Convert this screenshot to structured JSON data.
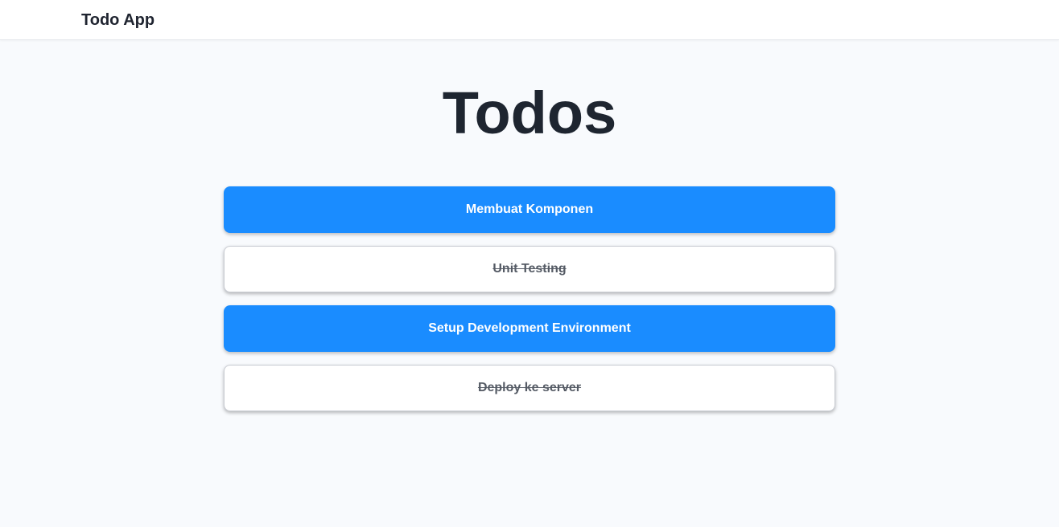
{
  "navbar": {
    "brand": "Todo App"
  },
  "main": {
    "title": "Todos",
    "todos": [
      {
        "label": "Membuat Komponen",
        "completed": false
      },
      {
        "label": "Unit Testing",
        "completed": true
      },
      {
        "label": "Setup Development Environment",
        "completed": false
      },
      {
        "label": "Deploy ke server",
        "completed": true
      }
    ]
  },
  "colors": {
    "accent": "#1a8cff",
    "background": "#f8fafd",
    "title_text": "#1e2530",
    "done_text": "#555b65"
  }
}
